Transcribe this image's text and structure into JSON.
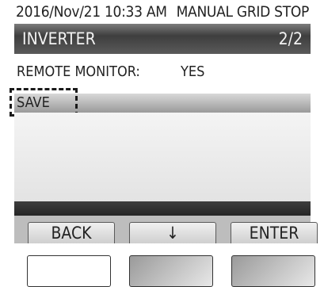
{
  "status": {
    "datetime": "2016/Nov/21 10:33 AM",
    "mode": "MANUAL GRID STOP"
  },
  "header": {
    "title": "INVERTER",
    "page": "2/2"
  },
  "settings": {
    "items": [
      {
        "label": "REMOTE MONITOR:",
        "value": "YES"
      },
      {
        "label": "SAVE"
      }
    ]
  },
  "softkeys": {
    "back": "BACK",
    "down": "↓",
    "enter": "ENTER"
  }
}
